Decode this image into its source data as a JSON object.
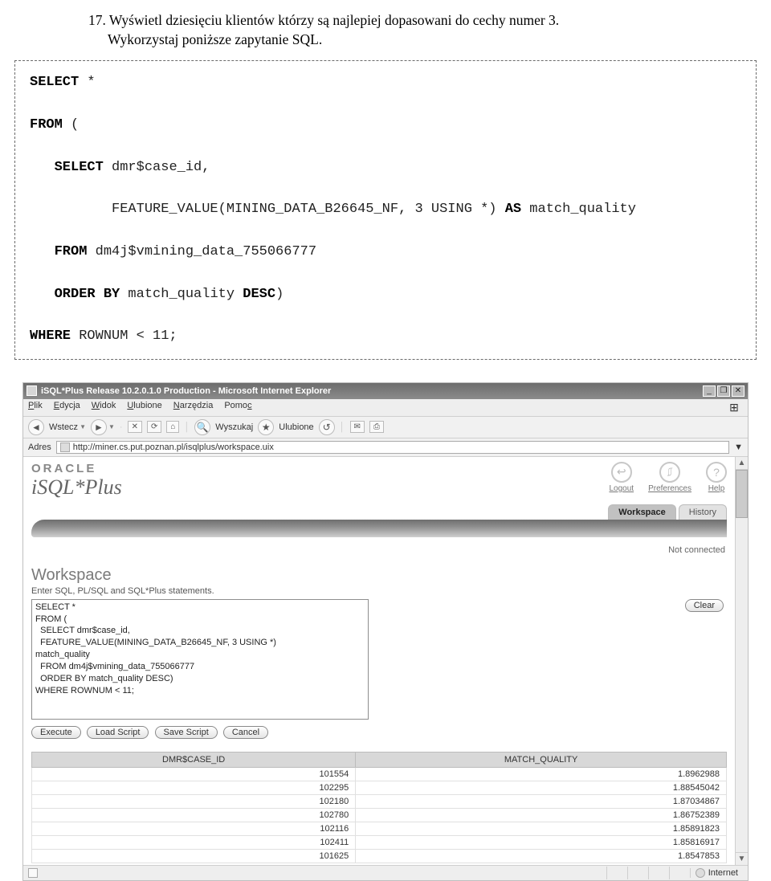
{
  "doc": {
    "line1": "17. Wyświetl dziesięciu klientów którzy są najlepiej dopasowani do cechy numer 3.",
    "line2": "Wykorzystaj poniższe zapytanie SQL."
  },
  "sql_block": {
    "kw_select": "SELECT",
    "star": " *",
    "kw_from": "FROM",
    "paren_open": " (",
    "kw_select2": "SELECT",
    "col_caseid": " dmr$case_id,",
    "fv_line_a": "          FEATURE_VALUE(MINING_DATA_B26645_NF, 3 USING *) ",
    "kw_as": "AS",
    "fv_line_b": " match_quality",
    "kw_from2": "FROM",
    "from_tbl": " dm4j$vmining_data_755066777",
    "kw_order": "ORDER BY",
    "order_rest": " match_quality ",
    "kw_desc": "DESC",
    "order_close": ")",
    "kw_where": "WHERE",
    "where_rest": " ROWNUM < 11;"
  },
  "ie": {
    "title": "iSQL*Plus Release 10.2.0.1.0 Production - Microsoft Internet Explorer",
    "min": "_",
    "max": "❐",
    "close": "✕",
    "menu": {
      "plik": "Plik",
      "edycja": "Edycja",
      "widok": "Widok",
      "ulubione": "Ulubione",
      "narzedzia": "Narzędzia",
      "pomoc": "Pomoc"
    },
    "tool": {
      "back": "Wstecz",
      "stop": "✕",
      "refresh": "⟳",
      "home": "⌂",
      "search": "Wyszukaj",
      "fav": "Ulubione"
    },
    "addr_label": "Adres",
    "addr_url": "http://miner.cs.put.poznan.pl/isqlplus/workspace.uix",
    "status_internet": "Internet"
  },
  "oracle": {
    "brand": "ORACLE",
    "prod": "iSQL*Plus",
    "links": {
      "logout": "Logout",
      "prefs": "Preferences",
      "help": "Help",
      "help_glyph": "?"
    },
    "tabs": {
      "workspace": "Workspace",
      "history": "History"
    },
    "not_connected": "Not connected",
    "ws_title": "Workspace",
    "ws_sub": "Enter SQL, PL/SQL and SQL*Plus statements.",
    "clear": "Clear",
    "buttons": {
      "execute": "Execute",
      "load": "Load Script",
      "save": "Save Script",
      "cancel": "Cancel"
    },
    "textarea_value": "SELECT *\nFROM (\n  SELECT dmr$case_id,\n  FEATURE_VALUE(MINING_DATA_B26645_NF, 3 USING *)\nmatch_quality\n  FROM dm4j$vmining_data_755066777\n  ORDER BY match_quality DESC)\nWHERE ROWNUM < 11;",
    "result_headers": {
      "col1": "DMR$CASE_ID",
      "col2": "MATCH_QUALITY"
    },
    "results": [
      {
        "case_id": "101554",
        "mq": "1.8962988"
      },
      {
        "case_id": "102295",
        "mq": "1.88545042"
      },
      {
        "case_id": "102180",
        "mq": "1.87034867"
      },
      {
        "case_id": "102780",
        "mq": "1.86752389"
      },
      {
        "case_id": "102116",
        "mq": "1.85891823"
      },
      {
        "case_id": "102411",
        "mq": "1.85816917"
      },
      {
        "case_id": "101625",
        "mq": "1.8547853"
      }
    ]
  }
}
